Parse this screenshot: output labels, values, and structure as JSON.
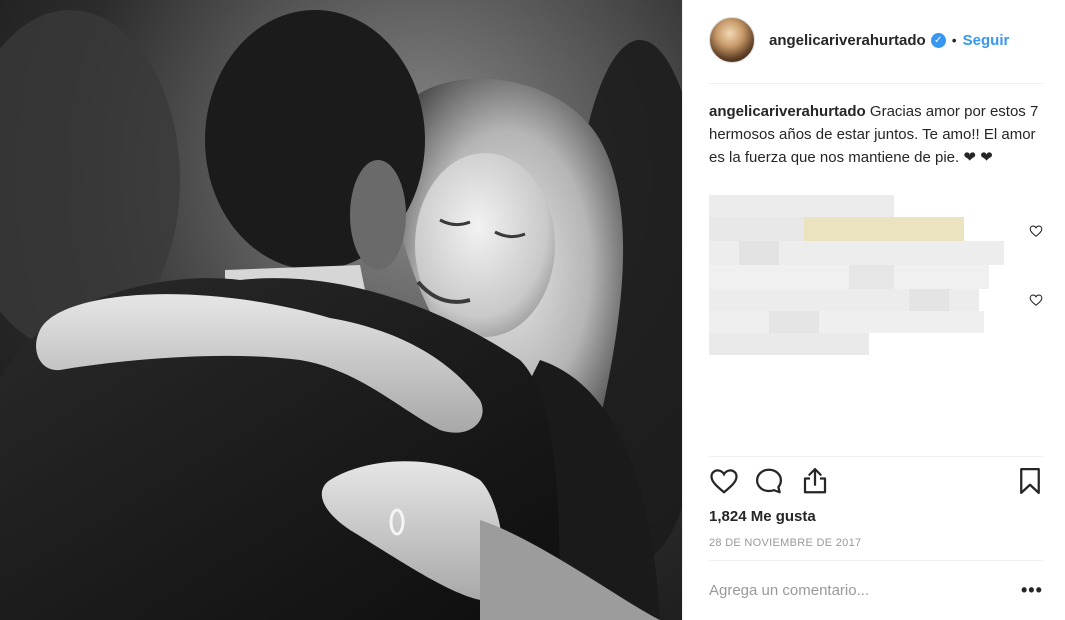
{
  "post": {
    "username": "angelicariverahurtado",
    "verified_icon": "✓",
    "separator": "•",
    "follow_label": "Seguir"
  },
  "caption": {
    "username": "angelicariverahurtado",
    "text": "Gracias amor por estos 7 hermosos años de estar juntos. Te amo!! El amor es la fuerza que nos mantiene de pie.",
    "hearts": "❤ ❤"
  },
  "stats": {
    "likes": "1,824 Me gusta",
    "date": "28 DE NOVIEMBRE DE 2017"
  },
  "comment": {
    "placeholder": "Agrega un comentario...",
    "more_label": "•••"
  },
  "icons": {
    "like": "heart-outline-icon",
    "comment": "speech-bubble-icon",
    "share": "share-icon",
    "save": "bookmark-icon"
  },
  "colors": {
    "accent": "#3897f0",
    "text": "#262626",
    "muted": "#999999"
  }
}
